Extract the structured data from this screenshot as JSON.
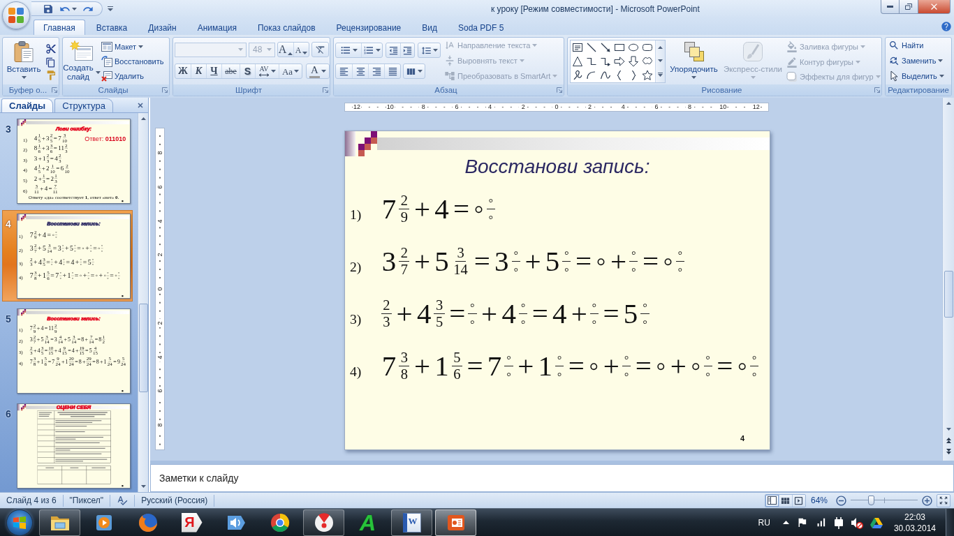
{
  "window": {
    "title": "к уроку [Режим совместимости] - Microsoft PowerPoint"
  },
  "tabs": [
    {
      "label": "Главная",
      "selected": true
    },
    {
      "label": "Вставка",
      "selected": false
    },
    {
      "label": "Дизайн",
      "selected": false
    },
    {
      "label": "Анимация",
      "selected": false
    },
    {
      "label": "Показ слайдов",
      "selected": false
    },
    {
      "label": "Рецензирование",
      "selected": false
    },
    {
      "label": "Вид",
      "selected": false
    },
    {
      "label": "Soda PDF 5",
      "selected": false
    }
  ],
  "ribbon": {
    "clipboard": {
      "label": "Буфер о...",
      "paste": "Вставить"
    },
    "slides": {
      "label": "Слайды",
      "new_slide": "Создать слайд",
      "buttons": [
        {
          "kind": "layout",
          "label": "Макет",
          "dropdown": true
        },
        {
          "kind": "reset",
          "label": "Восстановить",
          "dropdown": false
        },
        {
          "kind": "delete",
          "label": "Удалить",
          "dropdown": false
        }
      ]
    },
    "font": {
      "label": "Шрифт",
      "font_name": {
        "disabled": true
      },
      "font_size": {
        "value": "48",
        "disabled": true
      },
      "size_buttons": [
        {
          "kind": "grow",
          "label": "A"
        },
        {
          "kind": "shrink",
          "label": "A"
        }
      ],
      "style_buttons": [
        {
          "kind": "bold",
          "label": "Ж"
        },
        {
          "kind": "italic",
          "label": "К"
        },
        {
          "kind": "underline",
          "label": "Ч"
        },
        {
          "kind": "strike",
          "label": "abe"
        },
        {
          "kind": "shadow",
          "label": "S"
        },
        {
          "kind": "spacing",
          "label": "AV"
        },
        {
          "kind": "case",
          "label": "Aa"
        }
      ],
      "color_button": {
        "label": "A"
      }
    },
    "paragraph": {
      "label": "Абзац",
      "text_buttons": [
        {
          "kind": "direction",
          "label": "Направление текста",
          "disabled": true
        },
        {
          "kind": "align",
          "label": "Выровнять текст",
          "disabled": true
        },
        {
          "kind": "smartart",
          "label": "Преобразовать в SmartArt",
          "disabled": true
        }
      ]
    },
    "drawing": {
      "label": "Рисование",
      "arrange": {
        "label": "Упорядочить",
        "disabled": false
      },
      "quick_styles": {
        "label": "Экспресс-стили",
        "disabled": true
      },
      "shape_buttons": [
        {
          "kind": "fill",
          "label": "Заливка фигуры",
          "disabled": true
        },
        {
          "kind": "outline",
          "label": "Контур фигуры",
          "disabled": true
        },
        {
          "kind": "effects",
          "label": "Эффекты для фигур",
          "disabled": true
        }
      ]
    },
    "editing": {
      "label": "Редактирование",
      "buttons": [
        {
          "kind": "find",
          "label": "Найти",
          "dropdown": false
        },
        {
          "kind": "replace",
          "label": "Заменить",
          "dropdown": true
        },
        {
          "kind": "select",
          "label": "Выделить",
          "dropdown": true
        }
      ]
    }
  },
  "slide_panel": {
    "tabs": [
      {
        "label": "Слайды",
        "selected": true
      },
      {
        "label": "Структура",
        "selected": false
      }
    ],
    "thumbnails": [
      {
        "number": "3",
        "selected": false,
        "slide": {
          "kind": "quiz",
          "title": {
            "text": "Лови ошибку:",
            "color": "#e3001b"
          },
          "answer": "Ответ: **011010**",
          "equations": [
            {
              "label": "1)",
              "terms": [
                {
                  "kind": "text",
                  "text": "4"
                },
                {
                  "kind": "frac",
                  "num": "1",
                  "den": "5"
                },
                {
                  "kind": "text",
                  "text": "+ 3"
                },
                {
                  "kind": "frac",
                  "num": "2",
                  "den": "5"
                },
                {
                  "kind": "text",
                  "text": "= 7"
                },
                {
                  "kind": "frac",
                  "num": "3",
                  "den": "10"
                }
              ]
            },
            {
              "label": "2)",
              "terms": [
                {
                  "kind": "text",
                  "text": "8"
                },
                {
                  "kind": "frac",
                  "num": "1",
                  "den": "6"
                },
                {
                  "kind": "text",
                  "text": "+ 3"
                },
                {
                  "kind": "frac",
                  "num": "3",
                  "den": "6"
                },
                {
                  "kind": "text",
                  "text": "= 11"
                },
                {
                  "kind": "frac",
                  "num": "2",
                  "den": "3"
                }
              ]
            },
            {
              "label": "3)",
              "terms": [
                {
                  "kind": "text",
                  "text": "3 + 1"
                },
                {
                  "kind": "frac",
                  "num": "2",
                  "den": "3"
                },
                {
                  "kind": "text",
                  "text": "= 4"
                },
                {
                  "kind": "frac",
                  "num": "2",
                  "den": "3"
                }
              ]
            },
            {
              "label": "4)",
              "terms": [
                {
                  "kind": "text",
                  "text": "4"
                },
                {
                  "kind": "frac",
                  "num": "1",
                  "den": "5"
                },
                {
                  "kind": "text",
                  "text": "+ 2"
                },
                {
                  "kind": "frac",
                  "num": "1",
                  "den": "10"
                },
                {
                  "kind": "text",
                  "text": "= 6"
                },
                {
                  "kind": "frac",
                  "num": "2",
                  "den": "10"
                }
              ]
            },
            {
              "label": "5)",
              "terms": [
                {
                  "kind": "text",
                  "text": "2 +"
                },
                {
                  "kind": "frac",
                  "num": "1",
                  "den": "3"
                },
                {
                  "kind": "text",
                  "text": "= 2"
                },
                {
                  "kind": "frac",
                  "num": "1",
                  "den": "3"
                }
              ]
            },
            {
              "label": "6)",
              "terms": [
                {
                  "kind": "frac",
                  "num": "3",
                  "den": "11"
                },
                {
                  "kind": "text",
                  "text": "+ 4 ="
                },
                {
                  "kind": "frac",
                  "num": "7",
                  "den": "11"
                }
              ]
            }
          ],
          "note": "Ответу «да» соответствует **1**, ответ «нет» **0**."
        }
      },
      {
        "number": "4",
        "selected": true,
        "slide": {
          "kind": "equations",
          "title": {
            "text": "Восстанови запись:",
            "color": "#2b2862"
          },
          "equations": [
            {
              "label": "1)",
              "terms": [
                {
                  "kind": "text",
                  "text": "7"
                },
                {
                  "kind": "frac",
                  "num": "2",
                  "den": "9"
                },
                {
                  "kind": "text",
                  "text": "+ 4 = ◦"
                },
                {
                  "kind": "frac",
                  "num": "◦",
                  "den": "◦"
                }
              ]
            },
            {
              "label": "2)",
              "terms": [
                {
                  "kind": "text",
                  "text": "3"
                },
                {
                  "kind": "frac",
                  "num": "2",
                  "den": "7"
                },
                {
                  "kind": "text",
                  "text": "+ 5"
                },
                {
                  "kind": "frac",
                  "num": "3",
                  "den": "14"
                },
                {
                  "kind": "text",
                  "text": "= 3"
                },
                {
                  "kind": "frac",
                  "num": "◦",
                  "den": "◦"
                },
                {
                  "kind": "text",
                  "text": "+ 5"
                },
                {
                  "kind": "frac",
                  "num": "◦",
                  "den": "◦"
                },
                {
                  "kind": "text",
                  "text": "= ◦ +"
                },
                {
                  "kind": "frac",
                  "num": "◦",
                  "den": "◦"
                },
                {
                  "kind": "text",
                  "text": "= ◦"
                },
                {
                  "kind": "frac",
                  "num": "◦",
                  "den": "◦"
                }
              ]
            },
            {
              "label": "3)",
              "terms": [
                {
                  "kind": "frac",
                  "num": "2",
                  "den": "3"
                },
                {
                  "kind": "text",
                  "text": "+ 4"
                },
                {
                  "kind": "frac",
                  "num": "3",
                  "den": "5"
                },
                {
                  "kind": "text",
                  "text": "="
                },
                {
                  "kind": "frac",
                  "num": "◦",
                  "den": "◦"
                },
                {
                  "kind": "text",
                  "text": "+ 4"
                },
                {
                  "kind": "frac",
                  "num": "◦",
                  "den": "◦"
                },
                {
                  "kind": "text",
                  "text": "= 4 +"
                },
                {
                  "kind": "frac",
                  "num": "◦",
                  "den": "◦"
                },
                {
                  "kind": "text",
                  "text": "= 5"
                },
                {
                  "kind": "frac",
                  "num": "◦",
                  "den": "◦"
                }
              ]
            },
            {
              "label": "4)",
              "terms": [
                {
                  "kind": "text",
                  "text": "7"
                },
                {
                  "kind": "frac",
                  "num": "3",
                  "den": "8"
                },
                {
                  "kind": "text",
                  "text": "+ 1"
                },
                {
                  "kind": "frac",
                  "num": "5",
                  "den": "6"
                },
                {
                  "kind": "text",
                  "text": "= 7"
                },
                {
                  "kind": "frac",
                  "num": "◦",
                  "den": "◦"
                },
                {
                  "kind": "text",
                  "text": "+ 1"
                },
                {
                  "kind": "frac",
                  "num": "◦",
                  "den": "◦"
                },
                {
                  "kind": "text",
                  "text": "= ◦ +"
                },
                {
                  "kind": "frac",
                  "num": "◦",
                  "den": "◦"
                },
                {
                  "kind": "text",
                  "text": "= ◦ + ◦"
                },
                {
                  "kind": "frac",
                  "num": "◦",
                  "den": "◦"
                },
                {
                  "kind": "text",
                  "text": "= ◦"
                },
                {
                  "kind": "frac",
                  "num": "◦",
                  "den": "◦"
                }
              ]
            }
          ]
        }
      },
      {
        "number": "5",
        "selected": false,
        "slide": {
          "kind": "equations",
          "title": {
            "text": "Восстанови запись:",
            "color": "#e3001b"
          },
          "equations": [
            {
              "label": "1)",
              "terms": [
                {
                  "kind": "text",
                  "text": "7"
                },
                {
                  "kind": "frac",
                  "num": "2",
                  "den": "9"
                },
                {
                  "kind": "text",
                  "text": "+ 4 = 11"
                },
                {
                  "kind": "frac",
                  "num": "2",
                  "den": "9"
                }
              ]
            },
            {
              "label": "2)",
              "terms": [
                {
                  "kind": "text",
                  "text": "3"
                },
                {
                  "kind": "frac",
                  "num": "2",
                  "den": "7"
                },
                {
                  "kind": "text",
                  "text": "+ 5"
                },
                {
                  "kind": "frac",
                  "num": "3",
                  "den": "14"
                },
                {
                  "kind": "text",
                  "text": "= 3"
                },
                {
                  "kind": "frac",
                  "num": "4",
                  "den": "14"
                },
                {
                  "kind": "text",
                  "text": "+ 5"
                },
                {
                  "kind": "frac",
                  "num": "3",
                  "den": "14"
                },
                {
                  "kind": "text",
                  "text": "= 8 +"
                },
                {
                  "kind": "frac",
                  "num": "7",
                  "den": "14"
                },
                {
                  "kind": "text",
                  "text": "= 8"
                },
                {
                  "kind": "frac",
                  "num": "1",
                  "den": "2"
                }
              ]
            },
            {
              "label": "3)",
              "terms": [
                {
                  "kind": "frac",
                  "num": "2",
                  "den": "3"
                },
                {
                  "kind": "text",
                  "text": "+ 4"
                },
                {
                  "kind": "frac",
                  "num": "3",
                  "den": "5"
                },
                {
                  "kind": "text",
                  "text": "="
                },
                {
                  "kind": "frac",
                  "num": "10",
                  "den": "15"
                },
                {
                  "kind": "text",
                  "text": "+ 4"
                },
                {
                  "kind": "frac",
                  "num": "9",
                  "den": "15"
                },
                {
                  "kind": "text",
                  "text": "= 4 +"
                },
                {
                  "kind": "frac",
                  "num": "19",
                  "den": "15"
                },
                {
                  "kind": "text",
                  "text": "= 5"
                },
                {
                  "kind": "frac",
                  "num": "4",
                  "den": "15"
                }
              ]
            },
            {
              "label": "4)",
              "terms": [
                {
                  "kind": "text",
                  "text": "7"
                },
                {
                  "kind": "frac",
                  "num": "3",
                  "den": "8"
                },
                {
                  "kind": "text",
                  "text": "+ 1"
                },
                {
                  "kind": "frac",
                  "num": "5",
                  "den": "6"
                },
                {
                  "kind": "text",
                  "text": "= 7"
                },
                {
                  "kind": "frac",
                  "num": "9",
                  "den": "24"
                },
                {
                  "kind": "text",
                  "text": "+ 1"
                },
                {
                  "kind": "frac",
                  "num": "20",
                  "den": "24"
                },
                {
                  "kind": "text",
                  "text": "= 8 +"
                },
                {
                  "kind": "frac",
                  "num": "29",
                  "den": "24"
                },
                {
                  "kind": "text",
                  "text": "= 8 + 1"
                },
                {
                  "kind": "frac",
                  "num": "5",
                  "den": "24"
                },
                {
                  "kind": "text",
                  "text": "= 9"
                },
                {
                  "kind": "frac",
                  "num": "5",
                  "den": "24"
                }
              ]
            }
          ]
        }
      },
      {
        "number": "6",
        "selected": false,
        "slide": {
          "kind": "table",
          "title": {
            "text": "ОЦЕНИ СЕБЯ",
            "color": "#e3001b"
          }
        }
      }
    ]
  },
  "rulers": {
    "horizontal": [
      "12",
      "10",
      "8",
      "6",
      "4",
      "2",
      "0",
      "2",
      "4",
      "6",
      "8",
      "10",
      "12"
    ],
    "vertical": [
      "8",
      "6",
      "4",
      "2",
      "0",
      "2",
      "4",
      "6",
      "8"
    ]
  },
  "slide": {
    "kind": "equations",
    "title": {
      "text": "Восстанови запись:",
      "color": "#2b2862"
    },
    "equations": [
      {
        "label": "1)",
        "terms": [
          {
            "kind": "text",
            "text": "7"
          },
          {
            "kind": "frac",
            "num": "2",
            "den": "9"
          },
          {
            "kind": "text",
            "text": "+ 4 = ◦"
          },
          {
            "kind": "frac",
            "num": "◦",
            "den": "◦"
          }
        ]
      },
      {
        "label": "2)",
        "terms": [
          {
            "kind": "text",
            "text": "3"
          },
          {
            "kind": "frac",
            "num": "2",
            "den": "7"
          },
          {
            "kind": "text",
            "text": "+ 5"
          },
          {
            "kind": "frac",
            "num": "3",
            "den": "14"
          },
          {
            "kind": "text",
            "text": "= 3"
          },
          {
            "kind": "frac",
            "num": "◦",
            "den": "◦"
          },
          {
            "kind": "text",
            "text": "+ 5"
          },
          {
            "kind": "frac",
            "num": "◦",
            "den": "◦"
          },
          {
            "kind": "text",
            "text": "= ◦ +"
          },
          {
            "kind": "frac",
            "num": "◦",
            "den": "◦"
          },
          {
            "kind": "text",
            "text": "= ◦"
          },
          {
            "kind": "frac",
            "num": "◦",
            "den": "◦"
          }
        ]
      },
      {
        "label": "3)",
        "terms": [
          {
            "kind": "frac",
            "num": "2",
            "den": "3"
          },
          {
            "kind": "text",
            "text": "+ 4"
          },
          {
            "kind": "frac",
            "num": "3",
            "den": "5"
          },
          {
            "kind": "text",
            "text": "="
          },
          {
            "kind": "frac",
            "num": "◦",
            "den": "◦"
          },
          {
            "kind": "text",
            "text": "+ 4"
          },
          {
            "kind": "frac",
            "num": "◦",
            "den": "◦"
          },
          {
            "kind": "text",
            "text": "= 4 +"
          },
          {
            "kind": "frac",
            "num": "◦",
            "den": "◦"
          },
          {
            "kind": "text",
            "text": "= 5"
          },
          {
            "kind": "frac",
            "num": "◦",
            "den": "◦"
          }
        ]
      },
      {
        "label": "4)",
        "terms": [
          {
            "kind": "text",
            "text": "7"
          },
          {
            "kind": "frac",
            "num": "3",
            "den": "8"
          },
          {
            "kind": "text",
            "text": "+ 1"
          },
          {
            "kind": "frac",
            "num": "5",
            "den": "6"
          },
          {
            "kind": "text",
            "text": "= 7"
          },
          {
            "kind": "frac",
            "num": "◦",
            "den": "◦"
          },
          {
            "kind": "text",
            "text": "+ 1"
          },
          {
            "kind": "frac",
            "num": "◦",
            "den": "◦"
          },
          {
            "kind": "text",
            "text": "= ◦ +"
          },
          {
            "kind": "frac",
            "num": "◦",
            "den": "◦"
          },
          {
            "kind": "text",
            "text": "= ◦ + ◦"
          },
          {
            "kind": "frac",
            "num": "◦",
            "den": "◦"
          },
          {
            "kind": "text",
            "text": "= ◦"
          },
          {
            "kind": "frac",
            "num": "◦",
            "den": "◦"
          }
        ]
      }
    ],
    "number": "4"
  },
  "notes": {
    "placeholder": "Заметки к слайду"
  },
  "status_bar": {
    "slide": "Слайд 4 из 6",
    "theme": "\"Пиксел\"",
    "language": "Русский (Россия)",
    "views": [
      {
        "kind": "normal",
        "selected": true
      },
      {
        "kind": "sorter",
        "selected": false
      },
      {
        "kind": "show",
        "selected": false
      }
    ],
    "zoom": {
      "reading": "64%",
      "level": 0.3
    }
  },
  "taskbar": {
    "apps": [
      {
        "kind": "folder",
        "running": true,
        "selected": false
      },
      {
        "kind": "media",
        "running": false,
        "selected": false
      },
      {
        "kind": "fox",
        "running": false,
        "selected": false
      },
      {
        "kind": "tag",
        "glyph": "Я",
        "running": false,
        "selected": false
      },
      {
        "kind": "speaker",
        "running": false,
        "selected": false
      },
      {
        "kind": "wheel",
        "running": false,
        "selected": false
      },
      {
        "kind": "browser",
        "running": true,
        "selected": false
      },
      {
        "kind": "letter",
        "glyph": "A",
        "running": false,
        "selected": false
      },
      {
        "kind": "document",
        "glyph": "W",
        "running": true,
        "selected": false
      },
      {
        "kind": "presentation",
        "running": true,
        "selected": true
      }
    ],
    "language": "RU",
    "time": "22:03",
    "date": "30.03.2014"
  }
}
